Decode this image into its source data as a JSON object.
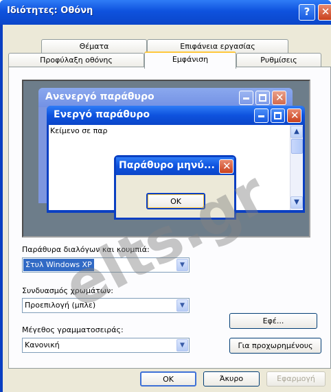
{
  "window": {
    "title": "Ιδιότητες: Οθόνη",
    "help_glyph": "?",
    "close_glyph": "✕"
  },
  "tabs": {
    "back_row": [
      "Θέματα",
      "Επιφάνεια εργασίας"
    ],
    "front_row": [
      "Προφύλαξη οθόνης",
      "Εμφάνιση",
      "Ρυθμίσεις"
    ],
    "active": "Εμφάνιση"
  },
  "preview": {
    "inactive_window_title": "Ανενεργό παράθυρο",
    "active_window_title": "Ενεργό παράθυρο",
    "window_text": "Κείμενο σε παρ",
    "message_box_title": "Παράθυρο μηνύ...",
    "message_box_ok": "OK"
  },
  "form": {
    "style_label": "Παράθυρα διαλόγων και κουμπιά:",
    "style_value": "Στυλ Windows XP",
    "color_label": "Συνδυασμός χρωμάτων:",
    "color_value": "Προεπιλογή (μπλε)",
    "font_label": "Μέγεθος γραμματοσειράς:",
    "font_value": "Κανονική",
    "effects_button": "Εφέ...",
    "advanced_button": "Για προχωρημένους"
  },
  "dialog_buttons": {
    "ok": "OK",
    "cancel": "Άκυρο",
    "apply": "Εφαρμογή"
  },
  "watermark": "elts.gr",
  "colors": {
    "titlebar_blue": "#0a3fc2",
    "dialog_face": "#ece9d8",
    "active_tab_accent": "#ffc83c",
    "close_red": "#c9401d",
    "selection_blue": "#316ac5"
  },
  "icons": [
    "help-icon",
    "close-icon",
    "minimize-icon",
    "maximize-icon",
    "scroll-up-icon",
    "scroll-down-icon",
    "dropdown-arrow-icon"
  ]
}
